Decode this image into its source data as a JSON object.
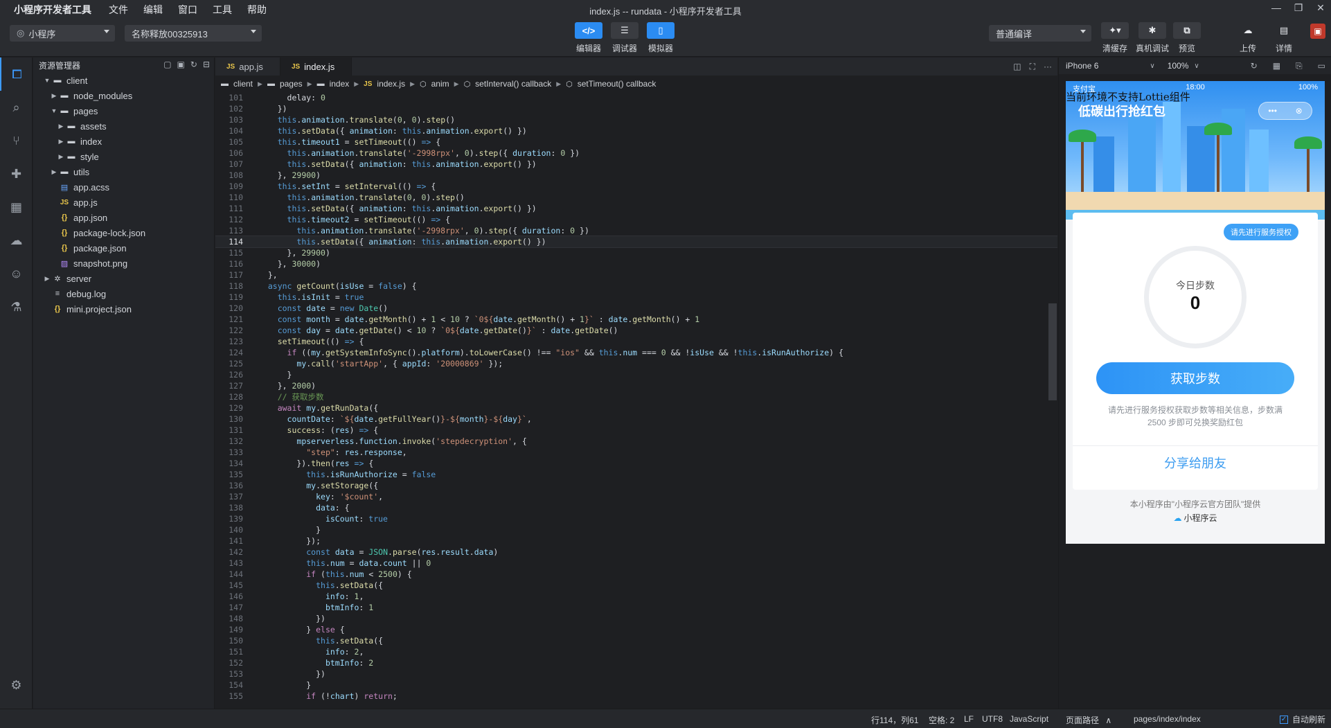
{
  "window_title": "index.js -- rundata - 小程序开发者工具",
  "menubar": {
    "items": [
      "小程序开发者工具",
      "文件",
      "编辑",
      "窗口",
      "工具",
      "帮助"
    ]
  },
  "toolbar": {
    "project_type": "小程序",
    "project_name": "名称释放00325913",
    "mode_buttons": [
      "编辑器",
      "调试器",
      "模拟器"
    ],
    "compile_mode": "普通编译",
    "right_buttons": [
      "清缓存",
      "真机调试",
      "预览",
      "上传",
      "详情"
    ]
  },
  "explorer": {
    "title": "资源管理器",
    "tree": [
      {
        "label": "client",
        "depth": 0,
        "type": "folder",
        "open": true
      },
      {
        "label": "node_modules",
        "depth": 1,
        "type": "folder",
        "open": false
      },
      {
        "label": "pages",
        "depth": 1,
        "type": "folder",
        "open": true
      },
      {
        "label": "assets",
        "depth": 2,
        "type": "folder",
        "open": false
      },
      {
        "label": "index",
        "depth": 2,
        "type": "folder",
        "open": false
      },
      {
        "label": "style",
        "depth": 2,
        "type": "folder",
        "open": false
      },
      {
        "label": "utils",
        "depth": 1,
        "type": "folder",
        "open": false
      },
      {
        "label": "app.acss",
        "depth": 1,
        "type": "acss"
      },
      {
        "label": "app.js",
        "depth": 1,
        "type": "js"
      },
      {
        "label": "app.json",
        "depth": 1,
        "type": "json"
      },
      {
        "label": "package-lock.json",
        "depth": 1,
        "type": "json"
      },
      {
        "label": "package.json",
        "depth": 1,
        "type": "json"
      },
      {
        "label": "snapshot.png",
        "depth": 1,
        "type": "img"
      },
      {
        "label": "server",
        "depth": 0,
        "type": "server",
        "open": false
      },
      {
        "label": "debug.log",
        "depth": 0,
        "type": "doc"
      },
      {
        "label": "mini.project.json",
        "depth": 0,
        "type": "json"
      }
    ]
  },
  "editor": {
    "tabs": [
      "app.js",
      "index.js"
    ],
    "active_tab": 1,
    "breadcrumb": [
      "client",
      "pages",
      "index",
      "index.js",
      "anim",
      "setInterval() callback",
      "setTimeout() callback"
    ],
    "current_line": 114,
    "lines": [
      {
        "n": 101,
        "html": "      delay: <span class='num'>0</span>"
      },
      {
        "n": 102,
        "html": "    })"
      },
      {
        "n": 103,
        "html": "    <span class='kw'>this</span>.<span class='prop'>animation</span>.<span class='fn'>translate</span>(<span class='num'>0</span>, <span class='num'>0</span>).<span class='fn'>step</span>()"
      },
      {
        "n": 104,
        "html": "    <span class='kw'>this</span>.<span class='fn'>setData</span>({ <span class='prop'>animation</span>: <span class='kw'>this</span>.<span class='prop'>animation</span>.<span class='fn'>export</span>() })"
      },
      {
        "n": 105,
        "html": "    <span class='kw'>this</span>.<span class='prop'>timeout1</span> = <span class='fn'>setTimeout</span>(() <span class='kw'>=&gt;</span> {"
      },
      {
        "n": 106,
        "html": "      <span class='kw'>this</span>.<span class='prop'>animation</span>.<span class='fn'>translate</span>(<span class='str'>'-2998rpx'</span>, <span class='num'>0</span>).<span class='fn'>step</span>({ <span class='prop'>duration</span>: <span class='num'>0</span> })"
      },
      {
        "n": 107,
        "html": "      <span class='kw'>this</span>.<span class='fn'>setData</span>({ <span class='prop'>animation</span>: <span class='kw'>this</span>.<span class='prop'>animation</span>.<span class='fn'>export</span>() })"
      },
      {
        "n": 108,
        "html": "    }, <span class='num'>29900</span>)"
      },
      {
        "n": 109,
        "html": "    <span class='kw'>this</span>.<span class='prop'>setInt</span> = <span class='fn'>setInterval</span>(() <span class='kw'>=&gt;</span> {"
      },
      {
        "n": 110,
        "html": "      <span class='kw'>this</span>.<span class='prop'>animation</span>.<span class='fn'>translate</span>(<span class='num'>0</span>, <span class='num'>0</span>).<span class='fn'>step</span>()"
      },
      {
        "n": 111,
        "html": "      <span class='kw'>this</span>.<span class='fn'>setData</span>({ <span class='prop'>animation</span>: <span class='kw'>this</span>.<span class='prop'>animation</span>.<span class='fn'>export</span>() })"
      },
      {
        "n": 112,
        "html": "      <span class='kw'>this</span>.<span class='prop'>timeout2</span> = <span class='fn'>setTimeout</span>(() <span class='kw'>=&gt;</span> {"
      },
      {
        "n": 113,
        "html": "        <span class='kw'>this</span>.<span class='prop'>animation</span>.<span class='fn'>translate</span>(<span class='str'>'-2998rpx'</span>, <span class='num'>0</span>).<span class='fn'>step</span>({ <span class='prop'>duration</span>: <span class='num'>0</span> })"
      },
      {
        "n": 114,
        "html": "        <span class='kw'>this</span>.<span class='fn'>setData</span>({ <span class='prop'>animation</span>: <span class='kw'>this</span>.<span class='prop'>animation</span>.<span class='fn'>export</span>() })"
      },
      {
        "n": 115,
        "html": "      }, <span class='num'>29900</span>)"
      },
      {
        "n": 116,
        "html": "    }, <span class='num'>30000</span>)"
      },
      {
        "n": 117,
        "html": "  },"
      },
      {
        "n": 118,
        "html": "  <span class='kw'>async</span> <span class='fn'>getCount</span>(<span class='prop'>isUse</span> = <span class='kw'>false</span>) {"
      },
      {
        "n": 119,
        "html": "    <span class='kw'>this</span>.<span class='prop'>isInit</span> = <span class='kw'>true</span>"
      },
      {
        "n": 120,
        "html": "    <span class='kw'>const</span> <span class='prop'>date</span> = <span class='kw'>new</span> <span class='cls'>Date</span>()"
      },
      {
        "n": 121,
        "html": "    <span class='kw'>const</span> <span class='prop'>month</span> = <span class='prop'>date</span>.<span class='fn'>getMonth</span>() + <span class='num'>1</span> &lt; <span class='num'>10</span> ? <span class='tpl'>`0${</span><span class='prop'>date</span>.<span class='fn'>getMonth</span>() + <span class='num'>1</span><span class='tpl'>}`</span> : <span class='prop'>date</span>.<span class='fn'>getMonth</span>() + <span class='num'>1</span>"
      },
      {
        "n": 122,
        "html": "    <span class='kw'>const</span> <span class='prop'>day</span> = <span class='prop'>date</span>.<span class='fn'>getDate</span>() &lt; <span class='num'>10</span> ? <span class='tpl'>`0${</span><span class='prop'>date</span>.<span class='fn'>getDate</span>()<span class='tpl'>}`</span> : <span class='prop'>date</span>.<span class='fn'>getDate</span>()"
      },
      {
        "n": 123,
        "html": "    <span class='fn'>setTimeout</span>(() <span class='kw'>=&gt;</span> {"
      },
      {
        "n": 124,
        "html": "      <span class='kw2'>if</span> ((<span class='prop'>my</span>.<span class='fn'>getSystemInfoSync</span>().<span class='prop'>platform</span>).<span class='fn'>toLowerCase</span>() !== <span class='str'>\"ios\"</span> &amp;&amp; <span class='kw'>this</span>.<span class='prop'>num</span> === <span class='num'>0</span> &amp;&amp; !<span class='prop'>isUse</span> &amp;&amp; !<span class='kw'>this</span>.<span class='prop'>isRunAuthorize</span>) {"
      },
      {
        "n": 125,
        "html": "        <span class='prop'>my</span>.<span class='fn'>call</span>(<span class='str'>'startApp'</span>, { <span class='prop'>appId</span>: <span class='str'>'20000869'</span> });"
      },
      {
        "n": 126,
        "html": "      }"
      },
      {
        "n": 127,
        "html": "    }, <span class='num'>2000</span>)"
      },
      {
        "n": 128,
        "html": "    <span class='cm'>// 获取步数</span>"
      },
      {
        "n": 129,
        "html": "    <span class='kw2'>await</span> <span class='prop'>my</span>.<span class='fn'>getRunData</span>({"
      },
      {
        "n": 130,
        "html": "      <span class='prop'>countDate</span>: <span class='tpl'>`${</span><span class='prop'>date</span>.<span class='fn'>getFullYear</span>()<span class='tpl'>}-${</span><span class='prop'>month</span><span class='tpl'>}-${</span><span class='prop'>day</span><span class='tpl'>}`</span>,"
      },
      {
        "n": 131,
        "html": "      <span class='fn'>success</span>: (<span class='prop'>res</span>) <span class='kw'>=&gt;</span> {"
      },
      {
        "n": 132,
        "html": "        <span class='prop'>mpserverless</span>.<span class='prop'>function</span>.<span class='fn'>invoke</span>(<span class='str'>'stepdecryption'</span>, {"
      },
      {
        "n": 133,
        "html": "          <span class='str'>\"step\"</span>: <span class='prop'>res</span>.<span class='prop'>response</span>,"
      },
      {
        "n": 134,
        "html": "        }).<span class='fn'>then</span>(<span class='prop'>res</span> <span class='kw'>=&gt;</span> {"
      },
      {
        "n": 135,
        "html": "          <span class='kw'>this</span>.<span class='prop'>isRunAuthorize</span> = <span class='kw'>false</span>"
      },
      {
        "n": 136,
        "html": "          <span class='prop'>my</span>.<span class='fn'>setStorage</span>({"
      },
      {
        "n": 137,
        "html": "            <span class='prop'>key</span>: <span class='str'>'$count'</span>,"
      },
      {
        "n": 138,
        "html": "            <span class='prop'>data</span>: {"
      },
      {
        "n": 139,
        "html": "              <span class='prop'>isCount</span>: <span class='kw'>true</span>"
      },
      {
        "n": 140,
        "html": "            }"
      },
      {
        "n": 141,
        "html": "          });"
      },
      {
        "n": 142,
        "html": "          <span class='kw'>const</span> <span class='prop'>data</span> = <span class='cls'>JSON</span>.<span class='fn'>parse</span>(<span class='prop'>res</span>.<span class='prop'>result</span>.<span class='prop'>data</span>)"
      },
      {
        "n": 143,
        "html": "          <span class='kw'>this</span>.<span class='prop'>num</span> = <span class='prop'>data</span>.<span class='prop'>count</span> || <span class='num'>0</span>"
      },
      {
        "n": 144,
        "html": "          <span class='kw2'>if</span> (<span class='kw'>this</span>.<span class='prop'>num</span> &lt; <span class='num'>2500</span>) {"
      },
      {
        "n": 145,
        "html": "            <span class='kw'>this</span>.<span class='fn'>setData</span>({"
      },
      {
        "n": 146,
        "html": "              <span class='prop'>info</span>: <span class='num'>1</span>,"
      },
      {
        "n": 147,
        "html": "              <span class='prop'>btmInfo</span>: <span class='num'>1</span>"
      },
      {
        "n": 148,
        "html": "            })"
      },
      {
        "n": 149,
        "html": "          } <span class='kw2'>else</span> {"
      },
      {
        "n": 150,
        "html": "            <span class='kw'>this</span>.<span class='fn'>setData</span>({"
      },
      {
        "n": 151,
        "html": "              <span class='prop'>info</span>: <span class='num'>2</span>,"
      },
      {
        "n": 152,
        "html": "              <span class='prop'>btmInfo</span>: <span class='num'>2</span>"
      },
      {
        "n": 153,
        "html": "            })"
      },
      {
        "n": 154,
        "html": "          }"
      },
      {
        "n": 155,
        "html": "          <span class='kw2'>if</span> (!<span class='prop'>chart</span>) <span class='kw2'>return</span>;"
      }
    ]
  },
  "simulator": {
    "device": "iPhone 6",
    "zoom": "100%",
    "status_carrier": "支付宝",
    "status_time": "18:00",
    "status_battery": "100%",
    "lottie_message": "当前环境不支持Lottie组件",
    "banner_title": "低碳出行抢红包",
    "auth_bubble": "请先进行服务授权",
    "steps_label": "今日步数",
    "steps_value": "0",
    "get_steps_button": "获取步数",
    "hint": "请先进行服务授权获取步数等相关信息，步数满 2500 步即可兑换奖励红包",
    "share_button": "分享给朋友",
    "provided_by": "本小程序由\"小程序云官方团队\"提供",
    "cloud_brand": "小程序云"
  },
  "statusbar": {
    "position": "行114，列61",
    "spaces": "空格: 2",
    "eol": "LF",
    "encoding": "UTF8",
    "language": "JavaScript",
    "page_path_label": "页面路径",
    "page_path": "pages/index/index",
    "auto_refresh": "自动刷新"
  }
}
